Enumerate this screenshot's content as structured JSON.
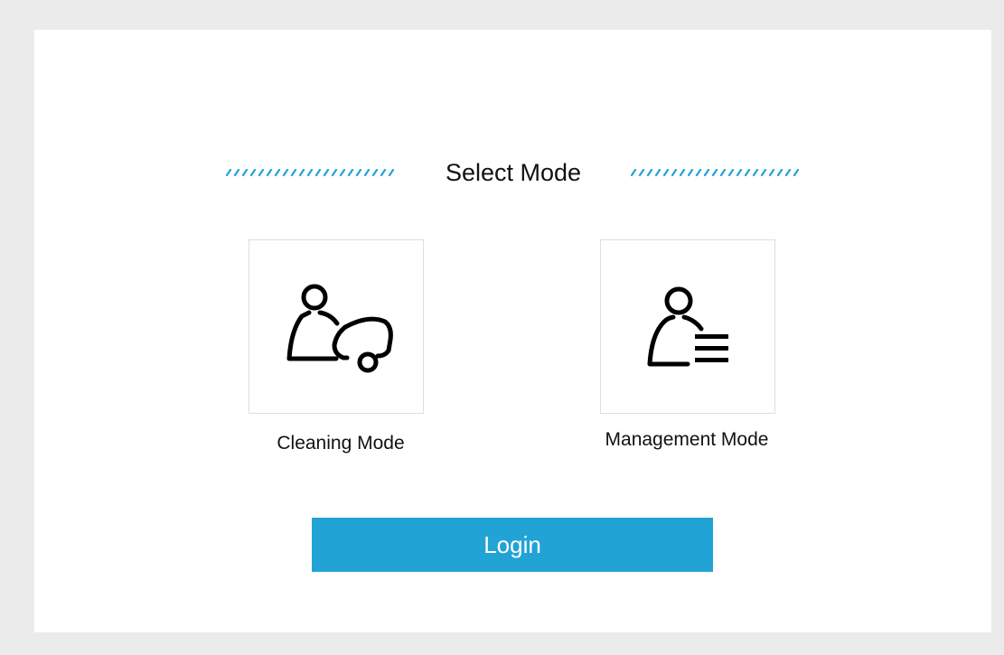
{
  "header": {
    "title": "Select Mode"
  },
  "modes": [
    {
      "label": "Cleaning Mode",
      "icon": "person-cleaning-machine-icon"
    },
    {
      "label": "Management Mode",
      "icon": "person-list-icon"
    }
  ],
  "actions": {
    "login_label": "Login"
  },
  "colors": {
    "accent": "#22a3d6",
    "background": "#ebebeb",
    "panel": "#ffffff",
    "icon": "#000000"
  }
}
